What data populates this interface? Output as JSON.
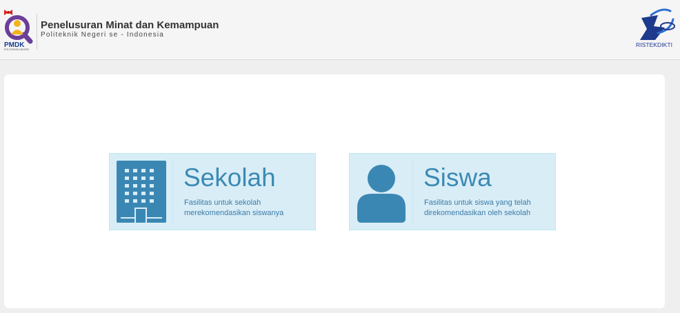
{
  "header": {
    "title": "Penelusuran Minat dan Kemampuan",
    "subtitle": "Politeknik Negeri se - Indonesia",
    "logo_left": {
      "icon": "pmdk-logo",
      "text": "PMDK",
      "tagline": "POLITEKNIK NEGERI"
    },
    "logo_right": {
      "icon": "ristekdikti-logo",
      "text": "RISTEKDIKTI"
    }
  },
  "cards": [
    {
      "id": "sekolah",
      "icon": "building-icon",
      "title": "Sekolah",
      "description": "Fasilitas untuk sekolah merekomendasikan siswanya"
    },
    {
      "id": "siswa",
      "icon": "user-icon",
      "title": "Siswa",
      "description": "Fasilitas untuk siswa yang telah direkomendasikan oleh sekolah"
    }
  ],
  "colors": {
    "card_background": "#d9edf7",
    "card_border": "#bce8f1",
    "accent": "#3b8ab3",
    "header_background": "#f5f5f5",
    "page_background": "#efefef"
  }
}
